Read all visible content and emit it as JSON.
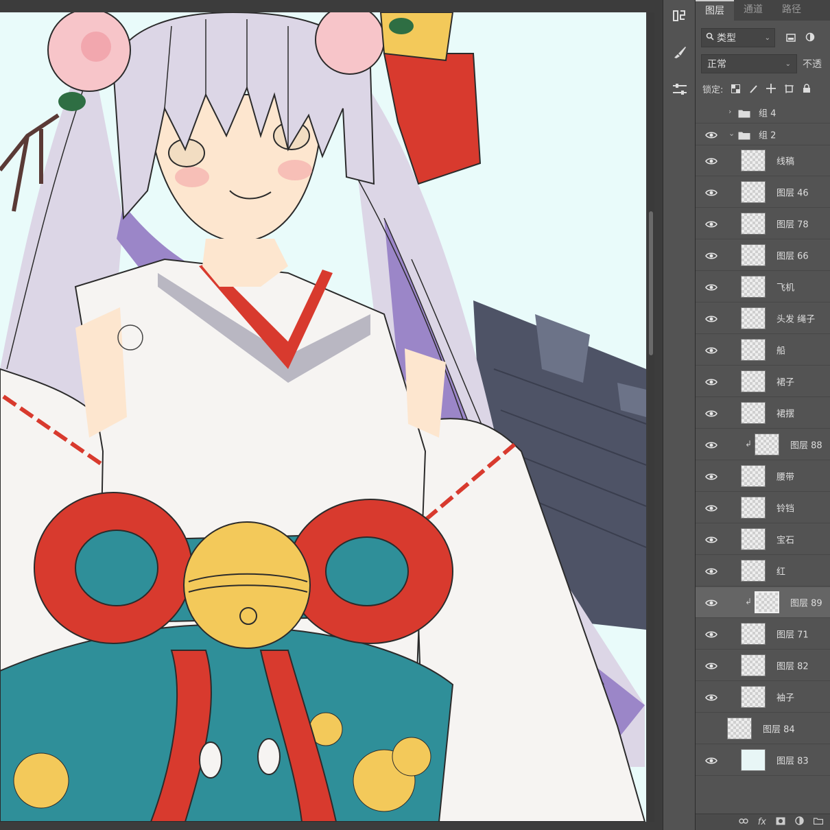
{
  "panel": {
    "tabs": [
      "图层",
      "通道",
      "路径"
    ],
    "filter_label": "类型",
    "blend_mode": "正常",
    "opacity_label": "不透",
    "lock_label": "锁定:"
  },
  "layers": [
    {
      "name": "组 4",
      "type": "group",
      "expanded": false,
      "visible": false
    },
    {
      "name": "组 2",
      "type": "group",
      "expanded": true,
      "visible": true
    },
    {
      "name": "线稿",
      "visible": true
    },
    {
      "name": "图层 46",
      "visible": true
    },
    {
      "name": "图层 78",
      "visible": true
    },
    {
      "name": "图层 66",
      "visible": true
    },
    {
      "name": "飞机",
      "visible": true
    },
    {
      "name": "头发 绳子",
      "visible": true
    },
    {
      "name": "船",
      "visible": true
    },
    {
      "name": "裙子",
      "visible": true
    },
    {
      "name": "裙摆",
      "visible": true
    },
    {
      "name": "图层 88",
      "visible": true,
      "clipped": true
    },
    {
      "name": "腰带",
      "visible": true
    },
    {
      "name": "铃铛",
      "visible": true
    },
    {
      "name": "宝石",
      "visible": true
    },
    {
      "name": "红",
      "visible": true
    },
    {
      "name": "图层 89",
      "visible": true,
      "clipped": true,
      "selected": true
    },
    {
      "name": "图层 71",
      "visible": true
    },
    {
      "name": "图层 82",
      "visible": true
    },
    {
      "name": "袖子",
      "visible": true
    },
    {
      "name": "图层 84",
      "visible": false
    },
    {
      "name": "图层 83",
      "visible": true,
      "solid": true
    }
  ],
  "bottom_icons": [
    "link-icon",
    "fx-icon",
    "mask-icon",
    "adjustment-icon",
    "folder-icon"
  ],
  "bottom_fx": "fx",
  "colors": {
    "canvas_bg": "#e9fbfa",
    "hair": "#dcd6e6",
    "hair_shadow": "#9b86c8",
    "robe": "#f6f4f2",
    "red": "#d83a2e",
    "gold": "#f3c95a",
    "teal": "#2f8f99",
    "skin": "#fde6cf",
    "ship": "#4e5366"
  }
}
